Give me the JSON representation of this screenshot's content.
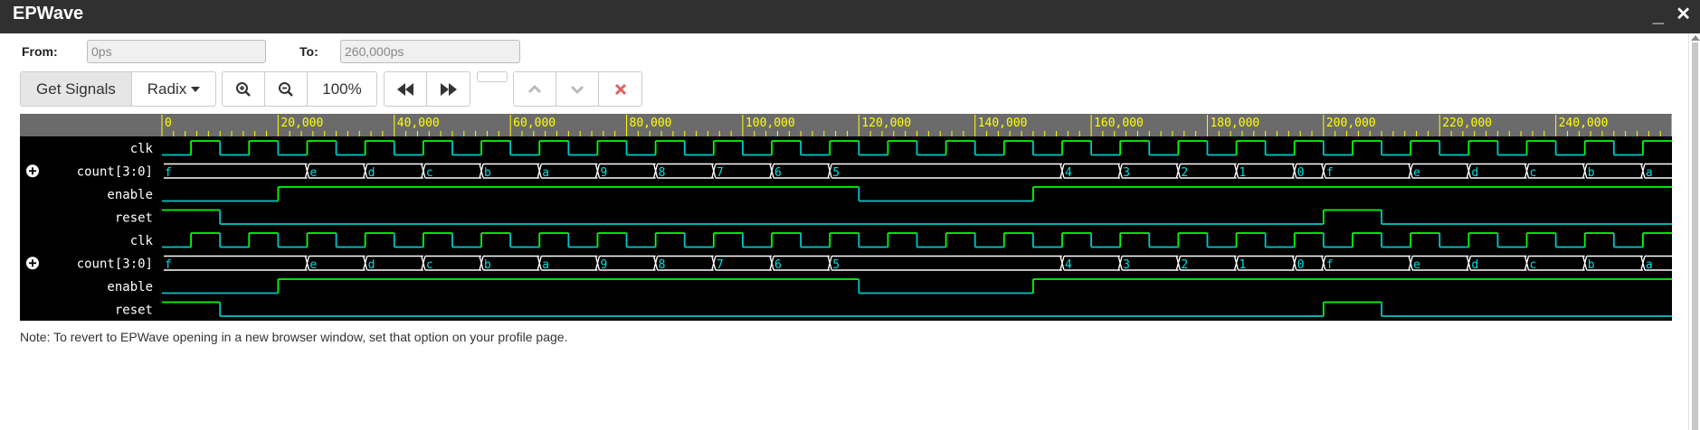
{
  "window": {
    "title": "EPWave",
    "minimize_label": "_",
    "close_label": "✕"
  },
  "range": {
    "from_label": "From:",
    "from_value": "0ps",
    "to_label": "To:",
    "to_value": "260,000ps"
  },
  "toolbar": {
    "get_signals_label": "Get Signals",
    "radix_label": "Radix",
    "zoom_in_icon": "zoom-in-icon",
    "zoom_out_icon": "zoom-out-icon",
    "zoom_level": "100%",
    "rewind_icon": "rewind-icon",
    "forward_icon": "fast-forward-icon",
    "up_icon": "chevron-up-icon",
    "down_icon": "chevron-down-icon",
    "remove_icon": "remove-icon"
  },
  "waveform": {
    "time_end": 260000,
    "ruler_labels": [
      "0",
      "20,000",
      "40,000",
      "60,000",
      "80,000",
      "100,000",
      "120,000",
      "140,000",
      "160,000",
      "180,000",
      "200,000",
      "220,000",
      "240,000"
    ],
    "ruler_values": [
      0,
      20000,
      40000,
      60000,
      80000,
      100000,
      120000,
      140000,
      160000,
      180000,
      200000,
      220000,
      240000
    ],
    "clk_period": 10000,
    "clk_first_rise": 5000,
    "count_values": [
      {
        "t": 0,
        "v": "f"
      },
      {
        "t": 25000,
        "v": "e"
      },
      {
        "t": 35000,
        "v": "d"
      },
      {
        "t": 45000,
        "v": "c"
      },
      {
        "t": 55000,
        "v": "b"
      },
      {
        "t": 65000,
        "v": "a"
      },
      {
        "t": 75000,
        "v": "9"
      },
      {
        "t": 85000,
        "v": "8"
      },
      {
        "t": 95000,
        "v": "7"
      },
      {
        "t": 105000,
        "v": "6"
      },
      {
        "t": 115000,
        "v": "5"
      },
      {
        "t": 155000,
        "v": "4"
      },
      {
        "t": 165000,
        "v": "3"
      },
      {
        "t": 175000,
        "v": "2"
      },
      {
        "t": 185000,
        "v": "1"
      },
      {
        "t": 195000,
        "v": "0"
      },
      {
        "t": 200000,
        "v": "f"
      },
      {
        "t": 215000,
        "v": "e"
      },
      {
        "t": 225000,
        "v": "d"
      },
      {
        "t": 235000,
        "v": "c"
      },
      {
        "t": 245000,
        "v": "b"
      },
      {
        "t": 255000,
        "v": "a"
      }
    ],
    "enable_high": [
      [
        20000,
        120000
      ],
      [
        150000,
        260000
      ]
    ],
    "reset_high": [
      [
        0,
        10000
      ],
      [
        200000,
        210000
      ]
    ],
    "signals": [
      {
        "name": "clk",
        "kind": "clk",
        "expandable": false
      },
      {
        "name": "count[3:0]",
        "kind": "bus",
        "expandable": true
      },
      {
        "name": "enable",
        "kind": "enable",
        "expandable": false
      },
      {
        "name": "reset",
        "kind": "reset",
        "expandable": false
      },
      {
        "name": "clk",
        "kind": "clk",
        "expandable": false
      },
      {
        "name": "count[3:0]",
        "kind": "bus",
        "expandable": true
      },
      {
        "name": "enable",
        "kind": "enable",
        "expandable": false
      },
      {
        "name": "reset",
        "kind": "reset",
        "expandable": false
      }
    ],
    "colors": {
      "background": "#000000",
      "ruler_bg": "#6b6b6b",
      "ruler_text": "#ffff00",
      "wave_high": "#00ff00",
      "wave_low": "#00c8c8",
      "bus": "#ffffff",
      "bus_text": "#00e0e0",
      "label": "#ffffff"
    }
  },
  "note": "Note: To revert to EPWave opening in a new browser window, set that option on your profile page."
}
